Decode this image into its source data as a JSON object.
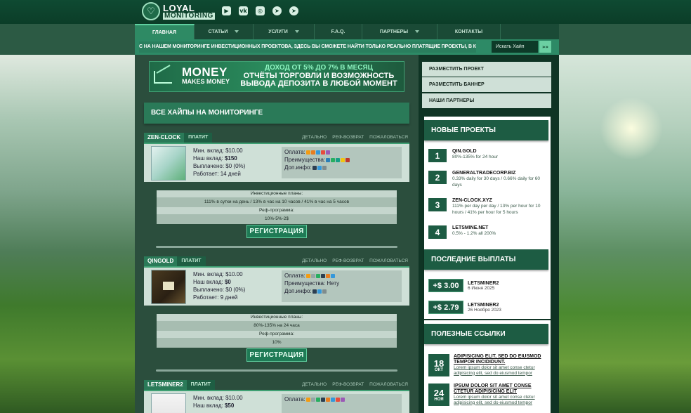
{
  "logo": {
    "line1": "LOYAL",
    "line2": "MONITORING"
  },
  "social": [
    {
      "name": "youtube-icon",
      "glyph": "▶"
    },
    {
      "name": "vk-icon",
      "glyph": "vk"
    },
    {
      "name": "instagram-icon",
      "glyph": "◎"
    },
    {
      "name": "telegram-icon",
      "glyph": "➤"
    },
    {
      "name": "telegram-alt-icon",
      "glyph": "➤"
    }
  ],
  "nav": [
    {
      "label": "Главная",
      "active": true,
      "dropdown": false
    },
    {
      "label": "Статьи",
      "active": false,
      "dropdown": true
    },
    {
      "label": "Услуги",
      "active": false,
      "dropdown": true
    },
    {
      "label": "F.A.Q.",
      "active": false,
      "dropdown": false
    },
    {
      "label": "Партнеры",
      "active": false,
      "dropdown": true
    },
    {
      "label": "Контакты",
      "active": false,
      "dropdown": false
    }
  ],
  "ticker": "С НА НАШЕМ МОНИТОРИНГЕ ИНВЕСТИЦИОННЫХ ПРОЕКТОВА, ЗДЕСЬ ВЫ СМОЖЕТЕ НАЙТИ ТОЛЬКО РЕАЛЬНО ПЛАТЯЩИЕ ПРОЕКТЫ, В КОТОРЫЕ ВЫ СМОЖЕТЕ ИНВЕСТИРОВАТ",
  "search": {
    "placeholder": "Искать Хайп",
    "button": "»»"
  },
  "banner": {
    "brand1": "MONEY",
    "brand2": "MAKES MONEY",
    "line1": "ДОХОД ОТ 5% ДО 7% В МЕСЯЦ",
    "line2": "ОТЧЁТЫ ТОРГОВЛИ И ВОЗМОЖНОСТЬ",
    "line3": "ВЫВОДА ДЕПОЗИТА В ЛЮБОЙ МОМЕНТ"
  },
  "section_title": "ВСЕ ХАЙПЫ НА МОНИТОРИНГЕ",
  "project_links": [
    "Детально",
    "Реф-возврат",
    "Пожаловаться"
  ],
  "register_label": "РЕГИСТРАЦИЯ",
  "projects": [
    {
      "name": "ZEN-CLOCK",
      "status": "ПЛАТИТ",
      "min": "Мин. вклад: $10.00",
      "deposit_label": "Наш вклад: ",
      "deposit": "$150",
      "paid": "Выплачено: $0 (0%)",
      "works": "Работает: 14 дней",
      "pay_label": "Оплата:",
      "adv_label": "Преимущества:",
      "info_label": "Доп.инфо:",
      "adv_value": "",
      "plans_header": "Инвестиционные планы:",
      "plans": "111% в сутки на день / 13% в час на 10 часов / 41% в час на 5 часов",
      "ref_header": "Реф-программа:",
      "ref": "10%-5%-2$"
    },
    {
      "name": "QINGOLD",
      "status": "ПЛАТИТ",
      "min": "Мин. вклад: $10.00",
      "deposit_label": "Наш вклад: ",
      "deposit": "$0",
      "paid": "Выплачено: $0 (0%)",
      "works": "Работает: 9 дней",
      "pay_label": "Оплата:",
      "adv_label": "Преимущества:",
      "info_label": "Доп.инфо:",
      "adv_value": "Нету",
      "plans_header": "Инвестиционные планы:",
      "plans": "80%-135% на 24 часа",
      "ref_header": "Реф-программа:",
      "ref": "10%"
    },
    {
      "name": "LETSMINER2",
      "status": "ПЛАТИТ",
      "min": "Мин. вклад: $10.00",
      "deposit_label": "Наш вклад: ",
      "deposit": "$50",
      "pay_label": "Оплата:"
    }
  ],
  "side_buttons": [
    "Разместить проект",
    "Разместить баннер",
    "Наши партнеры"
  ],
  "new_projects": {
    "title": "НОВЫЕ ПРОЕКТЫ",
    "items": [
      {
        "num": "1",
        "name": "QIN.GOLD",
        "desc": "80%-135% for 24 hour"
      },
      {
        "num": "2",
        "name": "GENERALTRADECORP.BIZ",
        "desc": "0.33% daily for 30 days / 0.66% daily for 60 days"
      },
      {
        "num": "3",
        "name": "ZEN-CLOCK.XYZ",
        "desc": "111% per day per day / 13% per hour for 10 hours / 41% per hour for 5 hours"
      },
      {
        "num": "4",
        "name": "LETSMINE.NET",
        "desc": "0.5% - 1.2% all 200%"
      }
    ]
  },
  "last_payouts": {
    "title": "ПОСЛЕДНИЕ ВЫПЛАТЫ",
    "items": [
      {
        "amount": "+$ 3.00",
        "name": "LETSMINER2",
        "date": "6 Июня 2025"
      },
      {
        "amount": "+$ 2.79",
        "name": "LETSMINER2",
        "date": "26 Ноября 2023"
      }
    ]
  },
  "useful_links": {
    "title": "ПОЛЕЗНЫЕ ССЫЛКИ",
    "items": [
      {
        "day": "18",
        "month": "ОКТ",
        "title": "ADIPISICING ELIT, SED DO EIUSMOD TEMPOR INCIDIDUNT.",
        "desc": "Lorem ipsum dolor sit amet conse ctetur adipisicing elit, sed do eiusmod tempor"
      },
      {
        "day": "24",
        "month": "НОЯ",
        "title": "IPSUM DOLOR SIT AMET CONSE CTETUR ADIPISICING ELIT",
        "desc": "Lorem ipsum dolor sit amet conse ctetur adipisicing elit, sed do eiusmod tempor"
      }
    ]
  },
  "colors": {
    "brand": "#2a7a58",
    "dark": "#0f3424",
    "accent": "#6bd0a3"
  }
}
